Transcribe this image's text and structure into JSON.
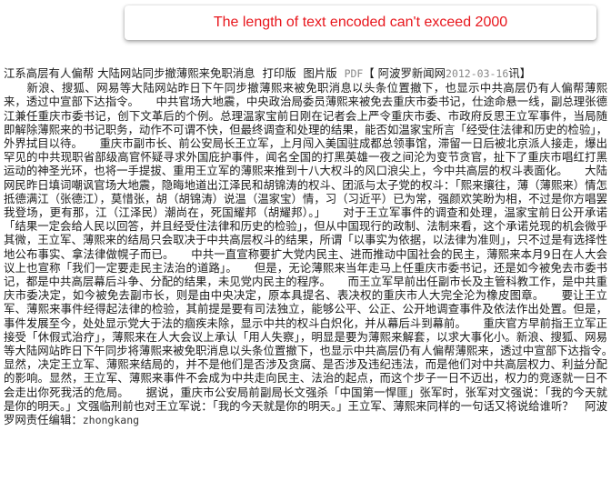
{
  "error": {
    "message": "The length of text encoded can't exceed 2000"
  },
  "article": {
    "headline_line": "江系高层有人偏帮  大陆网站同步撤薄熙来免职消息",
    "print_label": "打印版",
    "image_label": "图片版",
    "pdf_label": "PDF",
    "source_open": "【  阿波罗新闻网",
    "date": "2012-03-16",
    "source_close": "讯】",
    "body": "　　新浪、搜狐、网易等大陆网站昨日下午同步撤薄熙来被免职消息以头条位置撤下，也显示中共高层仍有人偏帮薄熙来，透过中宣部下达指令。　　中共官场大地震，中央政治局委员薄熙来被免去重庆市委书记，仕途命悬一线，副总理张德江兼任重庆市委书记，创下文革后的个例。总理温家宝前日刚在记者会上严令重庆市委、市政府反思王立军事件，当局随即解除薄熙来的书记职务，动作不可谓不快，但最终调查和处理的结果，能否如温家宝所言「经受住法律和历史的检验」，外界拭目以待。　　重庆市副市长、前公安局长王立军，上月闯入美国驻成都总领事馆，滞留一日后被北京派人接走，爆出罕见的中共现职省部级高官怀疑寻求外国庇护事件，闻名全国的打黑英雄一夜之间沦为变节贪官，扯下了重庆市唱红打黑运动的神圣光环，也将一手提拔、重用王立军的薄熙来推到十八大权斗的风口浪尖上，今中共高层的权斗表面化。　　大陆网民昨日填词嘲讽官场大地震，隐晦地道出江泽民和胡锦涛的权斗、团派与太子党的权斗：「熙来攘往，薄（薄熙来）情怎抵德满江（张德江），莫惜张，胡（胡锦涛）说温（温家宝）情，习（习近平）已为常，强颜欢笑盼为相，不过是你方唱罢我登场，更有那，江（江泽民）潮尚在，死国耀邦（胡耀邦）。」　　对于王立军事件的调查和处理，温家宝前日公开承诺「结果一定会给人民以回答，并且经受住法律和历史的检验」，但从中国现行的政制、法制来看，这个承诺兑现的机会微乎其微，王立军、薄熙来的结局只会取决于中共高层权斗的结果，所谓「以事实为依据，以法律为准则」，只不过是有选择性地公布事实、拿法律做幌子而已。　　中共一直宣称要扩大党内民主、进而推动中国社会的民主，薄熙来本月9日在人大会议上也宣称「我们一定要走民主法治的道路」。　　但是，无论薄熙来当年走马上任重庆市委书记，还是如今被免去市委书记，都是中共高层幕后斗争、分配的结果，未见党内民主的程序。　　而王立军早前出任副市长及主管科教工作，是中共重庆市委决定，如今被免去副市长，则是由中央决定，原本具提名、表决权的重庆市人大完全沦为橡皮图章。　　要让王立军、薄熙来事件经得起法律的检验，其前提是要有司法独立，能够公平、公正、公开地调查事件及依法作出处置。但是，事件发展至今，处处显示党大于法的痼疾未除，显示中共的权斗白炽化，并从幕后斗到幕前。　　重庆官方早前指王立军正接受「休假式治疗」，薄熙来在人大会议上承认「用人失察」，明显是要为薄熙来解套，以求大事化小。新浪、搜狐、网易等大陆网站昨日下午同步将薄熙来被免职消息以头条位置撤下，也显示中共高层仍有人偏帮薄熙来，透过中宣部下达指令。　　显然，决定王立军、薄熙来结局的，并不是他们是否涉及贪腐、是否涉及违纪违法，而是他们对中共高层权力、利益分配的影响。显然，王立军、薄熙来事件不会成为中共走向民主、法治的起点，而这个步子一日不迈出，权力的竞逐就一日不会走出你死我活的危局。　　据说，重庆市公安局前副局长文强杀「中国第一悍匪」张军时，张军对文强说：「我的今天就是你的明天。」文强临刑前也对王立军说：「我的今天就是你的明天。」王立军、薄熙来同样的一句话又将说给谁听？　阿波罗网责任编辑：",
    "editor": "zhongkang"
  }
}
